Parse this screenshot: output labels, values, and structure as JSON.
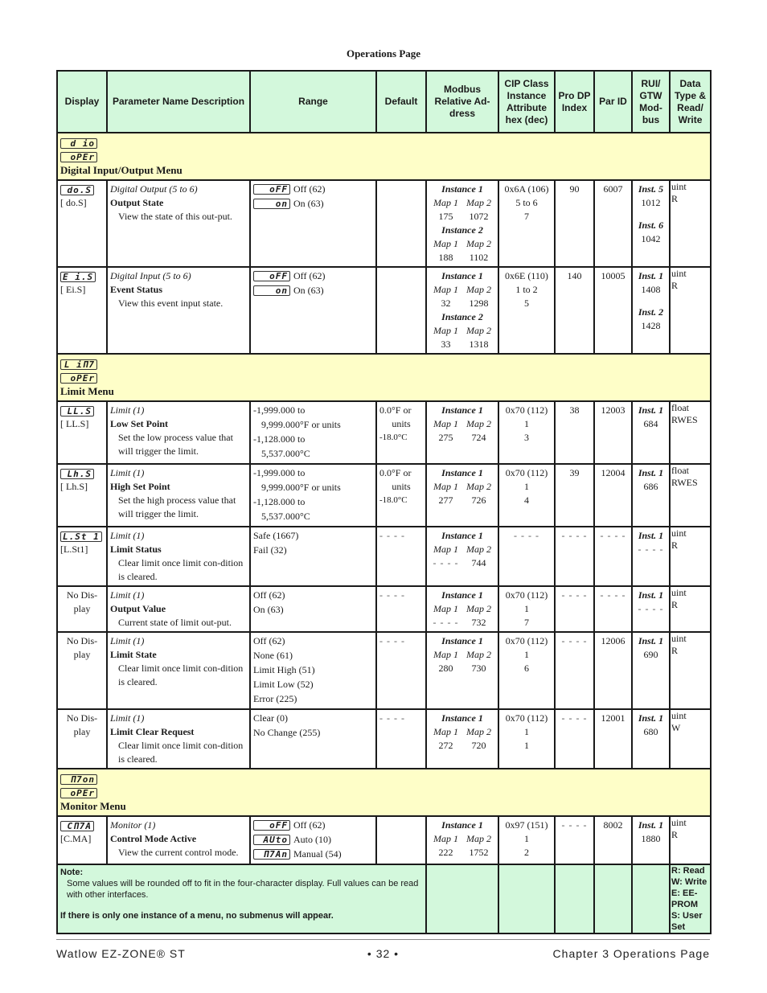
{
  "page_title": "Operations Page",
  "headers": [
    "Display",
    "Parameter Name Description",
    "Range",
    "Default",
    "Modbus Relative Ad-dress",
    "CIP Class Instance Attribute hex (dec)",
    "Pro DP Index",
    "Par ID",
    "RUI/ GTW Mod-bus",
    "Data Type & Read/ Write"
  ],
  "menus": [
    {
      "lcd_top": "d io",
      "lcd_bottom": "oPEr",
      "name": "Digital Input/Output Menu",
      "rows": [
        {
          "display_lcd": "do.S",
          "display_code": "[ do.S]",
          "group": "Digital Output (5 to 6)",
          "name": "Output State",
          "desc": "View the state of this out-put.",
          "range": [
            {
              "lcd": "oFF",
              "text": "Off (62)"
            },
            {
              "lcd": "on",
              "text": "On (63)"
            }
          ],
          "default": [],
          "modbus": [
            {
              "instance": "Instance 1",
              "map1": "175",
              "map2": "1072"
            },
            {
              "instance": "Instance 2",
              "map1": "188",
              "map2": "1102"
            }
          ],
          "cip": [
            "0x6A (106)",
            "5 to 6",
            "7"
          ],
          "prodp": "90",
          "parid": "6007",
          "rui": [
            {
              "inst": "Inst. 5",
              "val": "1012"
            },
            {
              "inst": "Inst. 6",
              "val": "1042"
            }
          ],
          "dtype": [
            "uint",
            "R"
          ]
        },
        {
          "display_lcd": "E i.S",
          "display_code": "[ Ei.S]",
          "group": "Digital Input (5 to 6)",
          "name": "Event Status",
          "desc": "View this event input state.",
          "range": [
            {
              "lcd": "oFF",
              "text": "Off (62)"
            },
            {
              "lcd": "on",
              "text": "On (63)"
            }
          ],
          "default": [],
          "modbus": [
            {
              "instance": "Instance 1",
              "map1": "32",
              "map2": "1298"
            },
            {
              "instance": "Instance 2",
              "map1": "33",
              "map2": "1318"
            }
          ],
          "cip": [
            "0x6E (110)",
            "1 to 2",
            "5"
          ],
          "prodp": "140",
          "parid": "10005",
          "rui": [
            {
              "inst": "Inst. 1",
              "val": "1408"
            },
            {
              "inst": "Inst. 2",
              "val": "1428"
            }
          ],
          "dtype": [
            "uint",
            "R"
          ]
        }
      ]
    },
    {
      "lcd_top": "L iΠ7",
      "lcd_bottom": "oPEr",
      "name": "Limit Menu",
      "rows": [
        {
          "display_lcd": "LL.S",
          "display_code": "[ LL.S]",
          "group": "Limit (1)",
          "name": "Low Set Point",
          "desc": "Set the low process value that will trigger the limit.",
          "range": [
            {
              "text": "-1,999.000 to"
            },
            {
              "text": "9,999.000°F or units",
              "indent": true
            },
            {
              "text": "-1,128.000 to"
            },
            {
              "text": "5,537.000°C",
              "indent": true
            }
          ],
          "default": [
            "0.0°F or",
            "units",
            "-18.0°C"
          ],
          "modbus": [
            {
              "instance": "Instance 1",
              "map1": "275",
              "map2": "724"
            }
          ],
          "cip": [
            "0x70 (112)",
            "1",
            "3"
          ],
          "prodp": "38",
          "parid": "12003",
          "rui": [
            {
              "inst": "Inst. 1",
              "val": "684"
            }
          ],
          "dtype": [
            "float",
            "RWES"
          ]
        },
        {
          "display_lcd": "Lh.S",
          "display_code": "[ Lh.S]",
          "group": "Limit (1)",
          "name": "High Set Point",
          "desc": "Set the high process value that will trigger the limit.",
          "range": [
            {
              "text": "-1,999.000 to"
            },
            {
              "text": "9,999.000°F or units",
              "indent": true
            },
            {
              "text": "-1,128.000 to"
            },
            {
              "text": "5,537.000°C",
              "indent": true
            }
          ],
          "default": [
            "0.0°F or",
            "units",
            "-18.0°C"
          ],
          "modbus": [
            {
              "instance": "Instance 1",
              "map1": "277",
              "map2": "726"
            }
          ],
          "cip": [
            "0x70 (112)",
            "1",
            "4"
          ],
          "prodp": "39",
          "parid": "12004",
          "rui": [
            {
              "inst": "Inst. 1",
              "val": "686"
            }
          ],
          "dtype": [
            "float",
            "RWES"
          ]
        },
        {
          "display_lcd": "L.St 1",
          "display_code": "[L.St1]",
          "group": "Limit (1)",
          "name": "Limit Status",
          "desc": "Clear limit once limit con-dition is cleared.",
          "range": [
            {
              "text": "Safe (1667)"
            },
            {
              "text": "Fail (32)"
            }
          ],
          "default": [
            "- - - -"
          ],
          "modbus": [
            {
              "instance": "Instance 1",
              "map1": "- - - -",
              "map2": "744"
            }
          ],
          "cip": [
            "- - - -"
          ],
          "prodp": "- - - -",
          "parid": "- - - -",
          "rui": [
            {
              "inst": "Inst. 1",
              "val": "- - - -"
            }
          ],
          "dtype": [
            "uint",
            "R"
          ]
        },
        {
          "display_lcd": "",
          "display_code": "No Dis-play",
          "group": "Limit (1)",
          "name": "Output Value",
          "desc": "Current state of limit out-put.",
          "range": [
            {
              "text": "Off (62)"
            },
            {
              "text": "On (63)"
            }
          ],
          "default": [
            "- - - -"
          ],
          "modbus": [
            {
              "instance": "Instance 1",
              "map1": "- - - -",
              "map2": "732"
            }
          ],
          "cip": [
            "0x70 (112)",
            "1",
            "7"
          ],
          "prodp": "- - - -",
          "parid": "- - - -",
          "rui": [
            {
              "inst": "Inst. 1",
              "val": "- - - -"
            }
          ],
          "dtype": [
            "uint",
            "R"
          ]
        },
        {
          "display_lcd": "",
          "display_code": "No Dis-play",
          "group": "Limit (1)",
          "name": "Limit State",
          "desc": "Clear limit once limit con-dition is cleared.",
          "range": [
            {
              "text": "Off (62)"
            },
            {
              "text": "None (61)"
            },
            {
              "text": "Limit High (51)"
            },
            {
              "text": "Limit Low (52)"
            },
            {
              "text": "Error (225)"
            }
          ],
          "default": [
            "- - - -"
          ],
          "modbus": [
            {
              "instance": "Instance 1",
              "map1": "280",
              "map2": "730"
            }
          ],
          "cip": [
            "0x70 (112)",
            "1",
            "6"
          ],
          "prodp": "- - - -",
          "parid": "12006",
          "rui": [
            {
              "inst": "Inst. 1",
              "val": "690"
            }
          ],
          "dtype": [
            "uint",
            "R"
          ]
        },
        {
          "display_lcd": "",
          "display_code": "No Dis-play",
          "group": "Limit (1)",
          "name": "Limit Clear Request",
          "desc": "Clear limit once limit con-dition is cleared.",
          "range": [
            {
              "text": "Clear (0)"
            },
            {
              "text": "No Change (255)"
            }
          ],
          "default": [
            "- - - -"
          ],
          "modbus": [
            {
              "instance": "Instance 1",
              "map1": "272",
              "map2": "720"
            }
          ],
          "cip": [
            "0x70 (112)",
            "1",
            "1"
          ],
          "prodp": "- - - -",
          "parid": "12001",
          "rui": [
            {
              "inst": "Inst. 1",
              "val": "680"
            }
          ],
          "dtype": [
            "uint",
            "W"
          ]
        }
      ]
    },
    {
      "lcd_top": "Π7on",
      "lcd_bottom": "oPEr",
      "name": "Monitor Menu",
      "rows": [
        {
          "display_lcd": "CΠ7A",
          "display_code": "[C.MA]",
          "group": "Monitor (1)",
          "name": "Control Mode Active",
          "desc": "View the current control mode.",
          "range": [
            {
              "lcd": "oFF",
              "text": "Off (62)"
            },
            {
              "lcd": "AUto",
              "text": "Auto (10)"
            },
            {
              "lcd": "Π7An",
              "text": "Manual (54)"
            }
          ],
          "default": [],
          "modbus": [
            {
              "instance": "Instance 1",
              "map1": "222",
              "map2": "1752"
            }
          ],
          "cip": [
            "0x97 (151)",
            "1",
            "2"
          ],
          "prodp": "- - - -",
          "parid": "8002",
          "rui": [
            {
              "inst": "Inst. 1",
              "val": "1880"
            }
          ],
          "dtype": [
            "uint",
            "R"
          ]
        }
      ]
    }
  ],
  "note": {
    "title": "Note:",
    "body": "Some values will be rounded off to fit in the four-character display. Full values can be read with other interfaces.",
    "footer": "If there is only one instance of a menu, no submenus will appear.",
    "legend": [
      "R: Read",
      "W: Write",
      "E: EE-PROM",
      "S: User Set"
    ]
  },
  "footer": {
    "left": "Watlow EZ-ZONE® ST",
    "center": "• 32 •",
    "right": "Chapter 3 Operations Page"
  }
}
